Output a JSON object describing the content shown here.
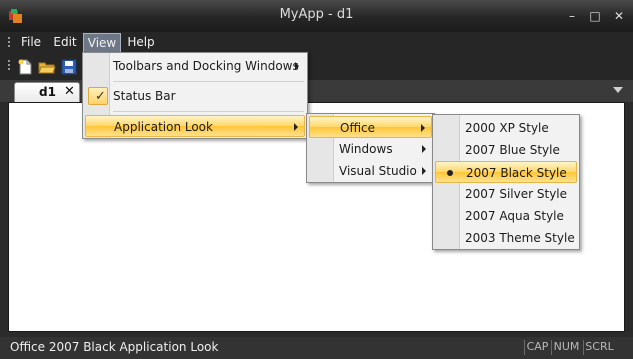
{
  "window": {
    "title": "MyApp - d1",
    "controls": [
      "–",
      "□",
      "✕"
    ]
  },
  "menubar": {
    "items": [
      "File",
      "Edit",
      "View",
      "Help"
    ]
  },
  "toolbar": {
    "buttons": [
      "new-file-icon",
      "open-folder-icon",
      "save-disk-icon"
    ]
  },
  "tabs": {
    "active": "d1",
    "close": "✕"
  },
  "view_menu": {
    "items": [
      {
        "label": "Toolbars and Docking Windows",
        "submenu": true
      },
      {
        "label": "Status Bar",
        "checked": true
      },
      {
        "label": "Application Look",
        "submenu": true,
        "highlighted": true
      }
    ]
  },
  "look_menu": {
    "items": [
      {
        "label": "Office",
        "submenu": true,
        "highlighted": true
      },
      {
        "label": "Windows",
        "submenu": true
      },
      {
        "label": "Visual Studio",
        "submenu": true
      }
    ]
  },
  "office_menu": {
    "items": [
      {
        "label": "2000 XP Style"
      },
      {
        "label": "2007 Blue Style"
      },
      {
        "label": "2007 Black Style",
        "selected": true,
        "highlighted": true
      },
      {
        "label": "2007 Silver Style"
      },
      {
        "label": "2007 Aqua Style"
      },
      {
        "label": "2003 Theme Style"
      }
    ]
  },
  "statusbar": {
    "text": "Office 2007 Black Application Look",
    "indicators": [
      "CAP",
      "NUM",
      "SCRL"
    ]
  },
  "colors": {
    "highlight": "#ffd76b",
    "frame": "#262626",
    "menu_bg": "#f2f2f2"
  }
}
